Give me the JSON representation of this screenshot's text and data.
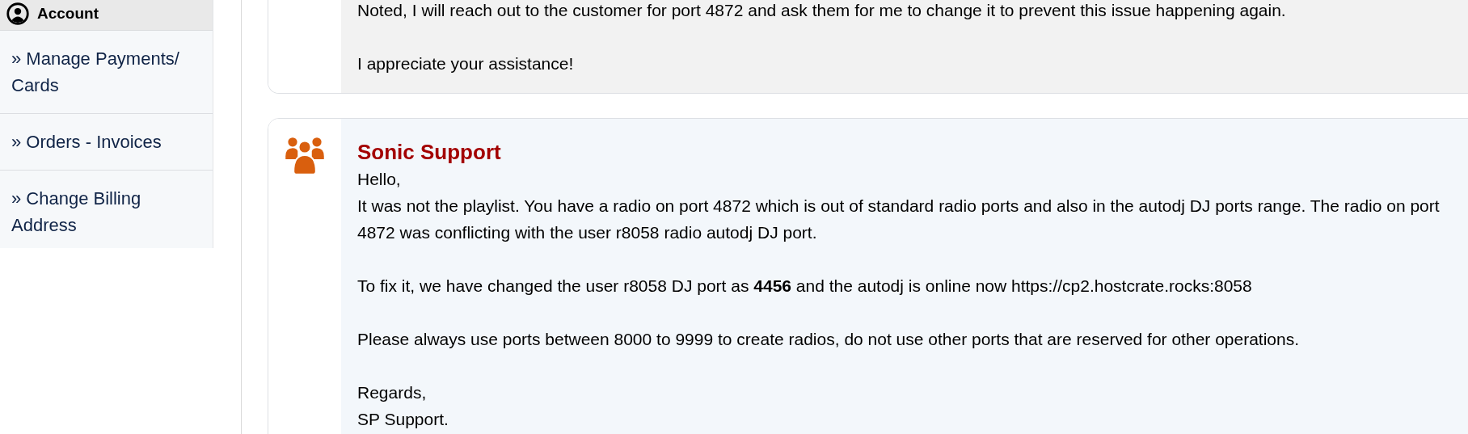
{
  "sidebar": {
    "header": "Account",
    "items": [
      {
        "lines": [
          "» Manage Payments/",
          "Cards"
        ]
      },
      {
        "lines": [
          "» Orders - Invoices"
        ]
      },
      {
        "lines": [
          "» Change Billing",
          "Address"
        ]
      }
    ]
  },
  "messages": [
    {
      "paragraphs": [
        [
          "Noted, I will reach out to the customer for port 4872 and ask them for me to change it to prevent this issue happening again."
        ],
        [
          "I appreciate your assistance!"
        ]
      ]
    },
    {
      "author": "Sonic Support",
      "paragraphs": [
        [
          "Hello,",
          "It was not the playlist. You have a radio on port 4872 which is out of standard radio ports and also in the autodj DJ ports range. The radio on port 4872 was conflicting with the user r8058 radio autodj DJ port."
        ],
        [
          "To fix it, we have changed the user r8058 DJ port as **4456** and the autodj is online now https://cp2.hostcrate.rocks:8058"
        ],
        [
          "Please always use ports between 8000 to 9999 to create radios, do not use other ports that are reserved for other operations."
        ],
        [
          "Regards,",
          "SP Support."
        ]
      ]
    }
  ]
}
